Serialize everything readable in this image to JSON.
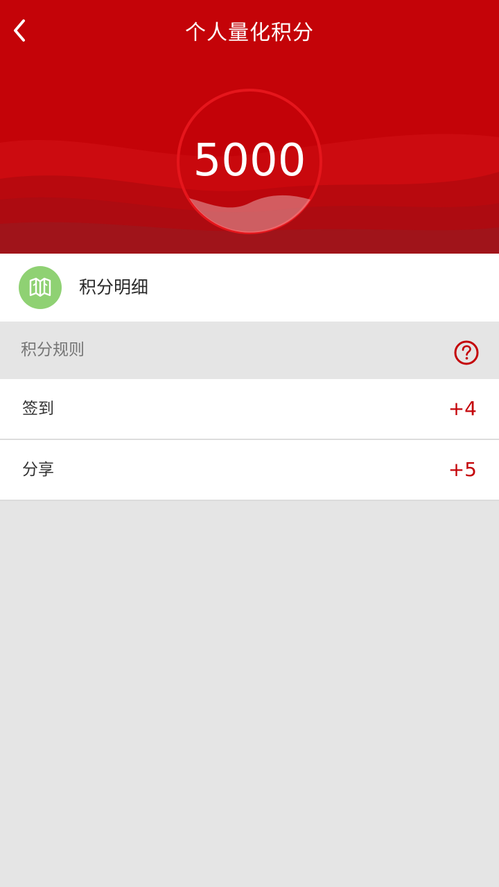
{
  "header": {
    "title": "个人量化积分",
    "back_icon": "chevron-left-icon"
  },
  "hero": {
    "score": "5000"
  },
  "detail": {
    "label": "积分明细",
    "icon": "map-icon",
    "icon_color": "#8fd173"
  },
  "rules": {
    "title": "积分规则",
    "help_icon": "question-circle-icon",
    "items": [
      {
        "name": "签到",
        "points": "+4"
      },
      {
        "name": "分享",
        "points": "+5"
      }
    ]
  },
  "colors": {
    "brand_red": "#c40308",
    "background": "#e5e5e5"
  }
}
